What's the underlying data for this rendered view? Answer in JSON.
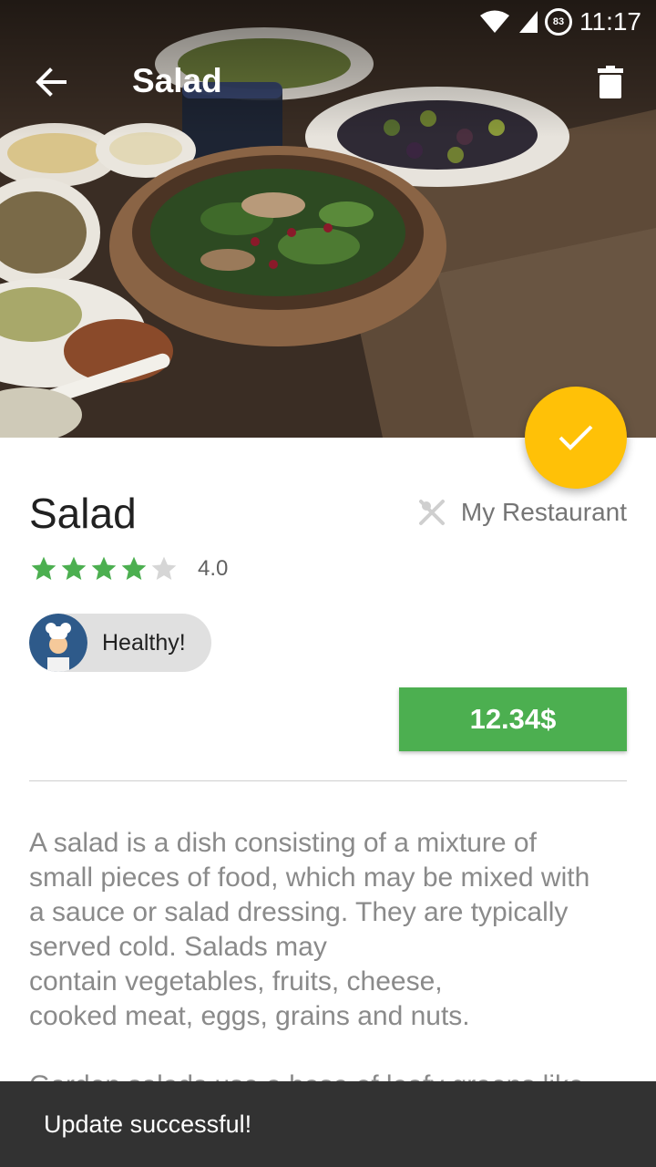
{
  "status_bar": {
    "time": "11:17",
    "battery_level": "83"
  },
  "toolbar": {
    "title": "Salad",
    "back_icon": "arrow-left-icon",
    "delete_icon": "trash-icon"
  },
  "fab": {
    "icon": "check-icon",
    "color": "#ffc107"
  },
  "dish": {
    "title": "Salad",
    "restaurant": "My Restaurant",
    "rating": {
      "value": "4.0",
      "stars": 4,
      "max": 5
    },
    "chip": {
      "label": "Healthy!"
    },
    "price": "12.34$",
    "description_paragraphs": [
      "A salad is a dish consisting of a mixture of\nsmall pieces of food, which may be mixed with\na sauce or salad dressing. They are typically\nserved cold. Salads may\ncontain vegetables, fruits, cheese,\ncooked meat, eggs, grains and nuts.",
      "Garden salads use a base of leafy greens like"
    ]
  },
  "snackbar": {
    "message": "Update successful!"
  },
  "colors": {
    "accent": "#ffc107",
    "price": "#4caf50",
    "star": "#4caf50",
    "star_empty": "#d6d6d6",
    "snackbar": "#323232"
  }
}
